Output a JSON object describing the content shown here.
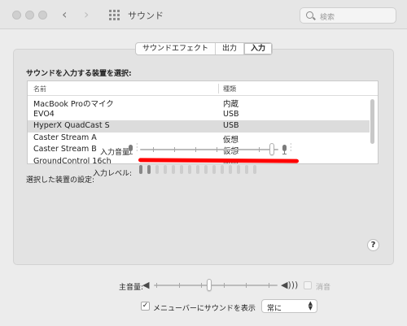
{
  "window": {
    "title": "サウンド",
    "search_placeholder": "検索"
  },
  "tabs": [
    {
      "label": "サウンドエフェクト",
      "selected": false
    },
    {
      "label": "出力",
      "selected": false
    },
    {
      "label": "入力",
      "selected": true
    }
  ],
  "input": {
    "heading": "サウンドを入力する装置を選択:",
    "columns": {
      "name": "名前",
      "type": "種類"
    },
    "devices": [
      {
        "name": "MacBook Proのマイク",
        "type": "内蔵",
        "selected": false
      },
      {
        "name": "EVO4",
        "type": "USB",
        "selected": false
      },
      {
        "name": "HyperX QuadCast S",
        "type": "USB",
        "selected": true
      },
      {
        "name": "Caster Stream A",
        "type": "仮想",
        "selected": false
      },
      {
        "name": "Caster Stream B",
        "type": "仮想",
        "selected": false
      },
      {
        "name": "GroundControl 16ch",
        "type": "仮想",
        "selected": false
      }
    ],
    "settings_heading": "選択した装置の設定:",
    "volume_label": "入力音量:",
    "volume_value": 0.95,
    "level_label": "入力レベル:",
    "level_segments": 15,
    "level_active": 2
  },
  "help_label": "?",
  "output": {
    "main_volume_label": "主音量:",
    "main_volume_value": 0.45,
    "mute_label": "消音",
    "mute_checked": false,
    "menubar_label": "メニューバーにサウンドを表示",
    "menubar_checked": true,
    "menubar_option": "常に"
  },
  "colors": {
    "annotation_red": "#ff0000",
    "selected_row": "#dcdcdc"
  }
}
